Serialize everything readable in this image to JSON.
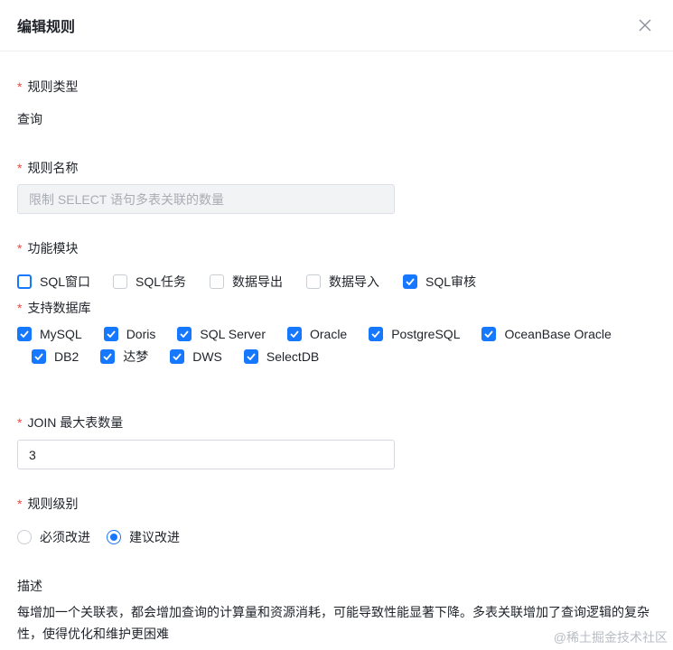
{
  "dialog": {
    "title": "编辑规则"
  },
  "rule_type": {
    "label": "规则类型",
    "value": "查询"
  },
  "rule_name": {
    "label": "规则名称",
    "value": "限制 SELECT 语句多表关联的数量"
  },
  "module": {
    "label": "功能模块",
    "options": [
      {
        "label": "SQL窗口",
        "checked": false
      },
      {
        "label": "SQL任务",
        "checked": false
      },
      {
        "label": "数据导出",
        "checked": false
      },
      {
        "label": "数据导入",
        "checked": false
      },
      {
        "label": "SQL审核",
        "checked": true
      }
    ]
  },
  "databases": {
    "label": "支持数据库",
    "options": [
      {
        "label": "MySQL",
        "checked": true
      },
      {
        "label": "Doris",
        "checked": true
      },
      {
        "label": "SQL Server",
        "checked": true
      },
      {
        "label": "Oracle",
        "checked": true
      },
      {
        "label": "PostgreSQL",
        "checked": true
      },
      {
        "label": "OceanBase Oracle",
        "checked": true
      },
      {
        "label": "DB2",
        "checked": true
      },
      {
        "label": "达梦",
        "checked": true
      },
      {
        "label": "DWS",
        "checked": true
      },
      {
        "label": "SelectDB",
        "checked": true
      }
    ]
  },
  "join_limit": {
    "label": "JOIN 最大表数量",
    "value": "3"
  },
  "level": {
    "label": "规则级别",
    "options": [
      {
        "label": "必须改进",
        "selected": false
      },
      {
        "label": "建议改进",
        "selected": true
      }
    ]
  },
  "description": {
    "label": "描述",
    "text": "每增加一个关联表，都会增加查询的计算量和资源消耗，可能导致性能显著下降。多表关联增加了查询逻辑的复杂性，使得优化和维护更困难"
  },
  "watermark": "@稀土掘金技术社区",
  "colors": {
    "accent": "#1677ff",
    "required": "#f5463d"
  }
}
